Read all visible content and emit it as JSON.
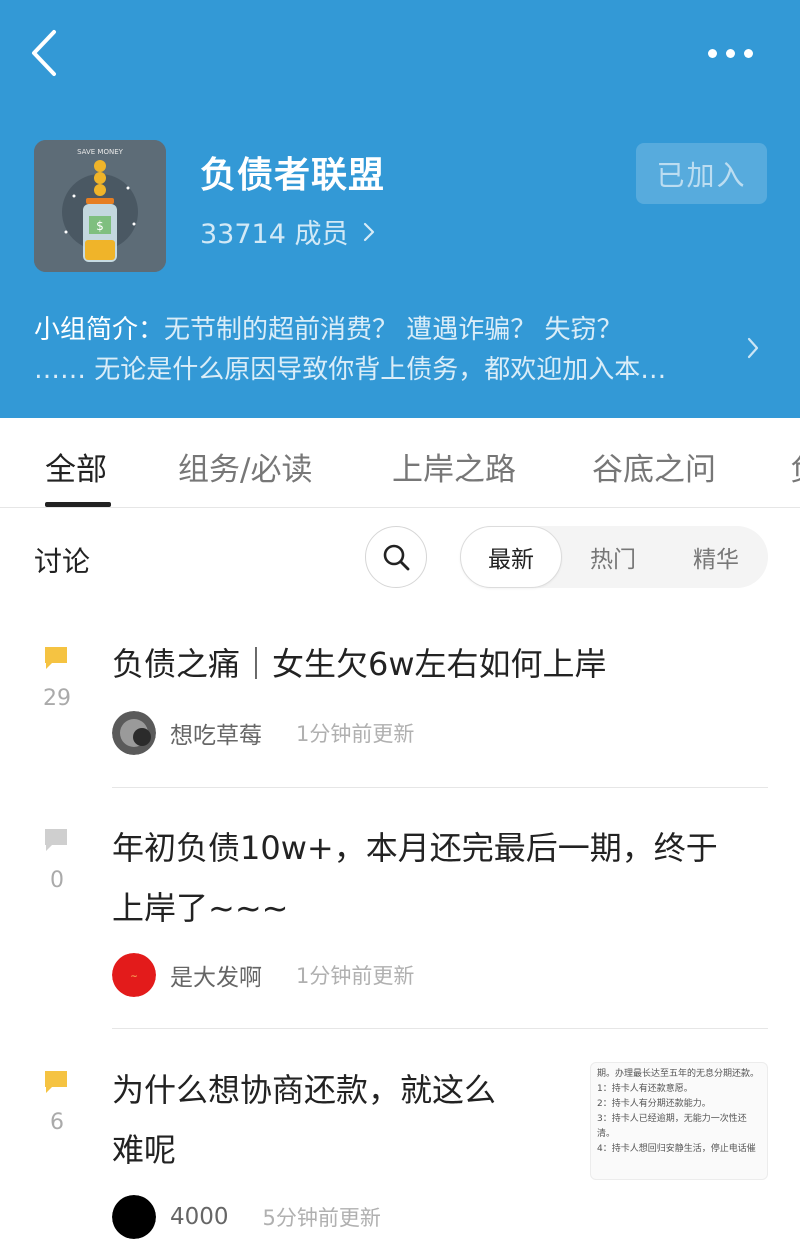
{
  "header": {
    "group_name": "负债者联盟",
    "member_count": "33714 成员",
    "join_button": "已加入",
    "logo_text": "SAVE MONEY",
    "intro_label": "小组简介：",
    "intro_line1": "无节制的超前消费？ 遭遇诈骗？ 失窃？",
    "intro_line2": "…… 无论是什么原因导致你背上债务，都欢迎加入本…"
  },
  "tabs": [
    "全部",
    "组务/必读",
    "上岸之路",
    "谷底之问",
    "负"
  ],
  "discussion": {
    "label": "讨论",
    "sort_options": [
      "最新",
      "热门",
      "精华"
    ],
    "active_sort": "最新"
  },
  "posts": [
    {
      "title_lines": [
        "负债之痛｜女生欠6w左右如何上岸"
      ],
      "count": "29",
      "author": "想吃草莓",
      "time": "1分钟前更新",
      "bubble_color": "#f5c342"
    },
    {
      "title_lines": [
        "年初负债10w+，本月还完最后一期，终于",
        "上岸了~~~"
      ],
      "count": "0",
      "author": "是大发啊",
      "time": "1分钟前更新",
      "bubble_color": "#cfcfcf"
    },
    {
      "title_lines": [
        "为什么想协商还款，就这么",
        "难呢"
      ],
      "count": "6",
      "author": "4000",
      "time": "5分钟前更新",
      "bubble_color": "#f5c342",
      "thumbnail_lines": [
        "期。办理最长达至五年的无息分期还款。",
        "1：持卡人有还款意愿。",
        "2：持卡人有分期还款能力。",
        "3：持卡人已经逾期，无能力一次性还",
        "清。",
        "4：持卡人想回归安静生活，停止电话催"
      ]
    }
  ],
  "colors": {
    "header_bg": "#3399d6",
    "accent_yellow": "#f5c342"
  }
}
